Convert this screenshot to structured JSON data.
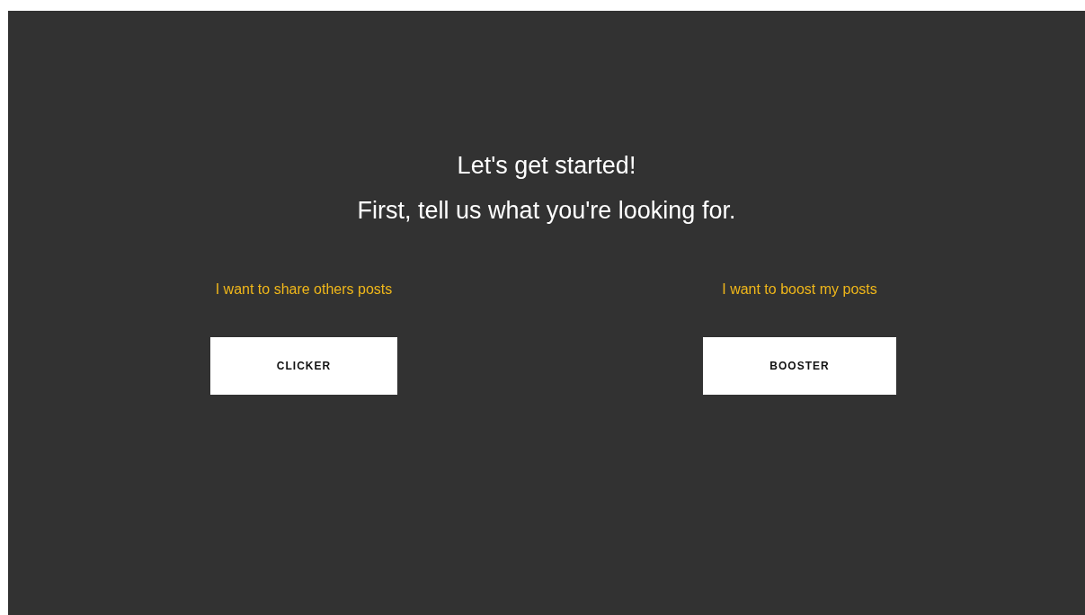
{
  "heading": {
    "title": "Let's get started!",
    "subtitle": "First, tell us what you're looking for."
  },
  "options": [
    {
      "description": "I want to share others posts",
      "button": "CLICKER"
    },
    {
      "description": "I want to boost my posts",
      "button": "BOOSTER"
    }
  ]
}
